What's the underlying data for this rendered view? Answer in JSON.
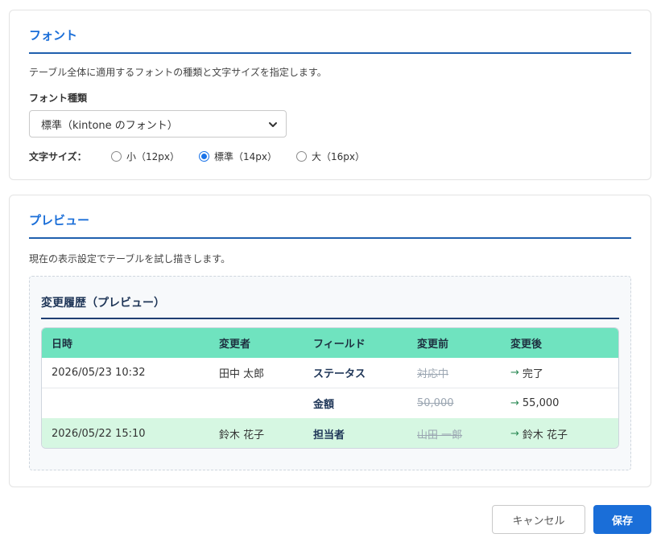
{
  "font_section": {
    "title": "フォント",
    "description": "テーブル全体に適用するフォントの種類と文字サイズを指定します。",
    "font_type_label": "フォント種類",
    "font_type_value": "標準（kintone のフォント）",
    "size_label": "文字サイズ：",
    "size_options": [
      {
        "label": "小（12px）",
        "checked": false
      },
      {
        "label": "標準（14px）",
        "checked": true
      },
      {
        "label": "大（16px）",
        "checked": false
      }
    ]
  },
  "preview_section": {
    "title": "プレビュー",
    "description": "現在の表示設定でテーブルを試し描きします。",
    "table_title": "変更履歴（プレビュー）",
    "columns": [
      "日時",
      "変更者",
      "フィールド",
      "変更前",
      "変更後"
    ],
    "rows": [
      {
        "datetime": "2026/05/23 10:32",
        "user": "田中 太郎",
        "field": "ステータス",
        "before": "対応中",
        "after": "完了"
      },
      {
        "datetime": "",
        "user": "",
        "field": "金額",
        "before": "50,000",
        "after": "55,000"
      },
      {
        "datetime": "2026/05/22 15:10",
        "user": "鈴木 花子",
        "field": "担当者",
        "before": "山田 一郎",
        "after": "鈴木 花子"
      }
    ],
    "arrow": "→"
  },
  "footer": {
    "cancel_label": "キャンセル",
    "save_label": "保存"
  },
  "colors": {
    "accent": "#1a6ed8",
    "header_row": "#6fe3bf",
    "highlight_row": "#d6f7e2"
  }
}
